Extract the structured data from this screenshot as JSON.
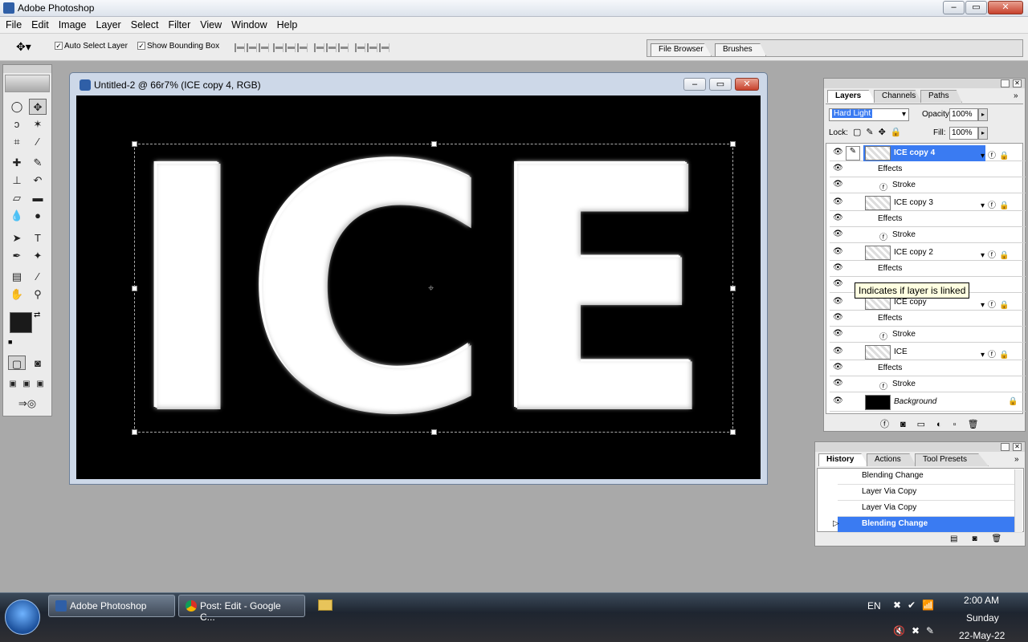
{
  "app": {
    "title": "Adobe Photoshop"
  },
  "menu": [
    "File",
    "Edit",
    "Image",
    "Layer",
    "Select",
    "Filter",
    "View",
    "Window",
    "Help"
  ],
  "options": {
    "auto_select_layer": "Auto Select Layer",
    "show_bounding_box": "Show Bounding Box",
    "auto_select_checked": true,
    "show_bbox_checked": true
  },
  "palette_well": {
    "tabs": [
      "File Browser",
      "Brushes"
    ]
  },
  "document": {
    "title": "Untitled-2 @ 66r7% (ICE copy 4, RGB)",
    "canvas_text": "ICE"
  },
  "layers_panel": {
    "tabs": [
      "Layers",
      "Channels",
      "Paths"
    ],
    "blend_mode": "Hard Light",
    "opacity_label": "Opacity:",
    "opacity": "100%",
    "lock_label": "Lock:",
    "fill_label": "Fill:",
    "fill": "100%",
    "layers": [
      {
        "name": "ICE copy 4",
        "effects": "Effects",
        "stroke": "Stroke",
        "selected": true
      },
      {
        "name": "ICE copy 3",
        "effects": "Effects",
        "stroke": "Stroke"
      },
      {
        "name": "ICE copy 2",
        "effects": "Effects",
        "stroke": ""
      },
      {
        "name": "ICE copy",
        "effects": "Effects",
        "stroke": "Stroke"
      },
      {
        "name": "ICE",
        "effects": "Effects",
        "stroke": "Stroke"
      },
      {
        "name": "Background"
      }
    ],
    "tooltip": "Indicates if layer is linked"
  },
  "history_panel": {
    "tabs": [
      "History",
      "Actions",
      "Tool Presets"
    ],
    "items": [
      "Blending Change",
      "Layer Via Copy",
      "Layer Via Copy",
      "Blending Change"
    ]
  },
  "taskbar": {
    "buttons": [
      "Adobe Photoshop",
      "Post: Edit - Google C..."
    ],
    "lang": "EN",
    "time": "2:00 AM",
    "day": "Sunday",
    "date": "22-May-22"
  },
  "colors": {
    "selection": "#3a7bf2",
    "canvas": "#000000",
    "foreground": "#1a1a1a",
    "background": "#ffffff"
  }
}
